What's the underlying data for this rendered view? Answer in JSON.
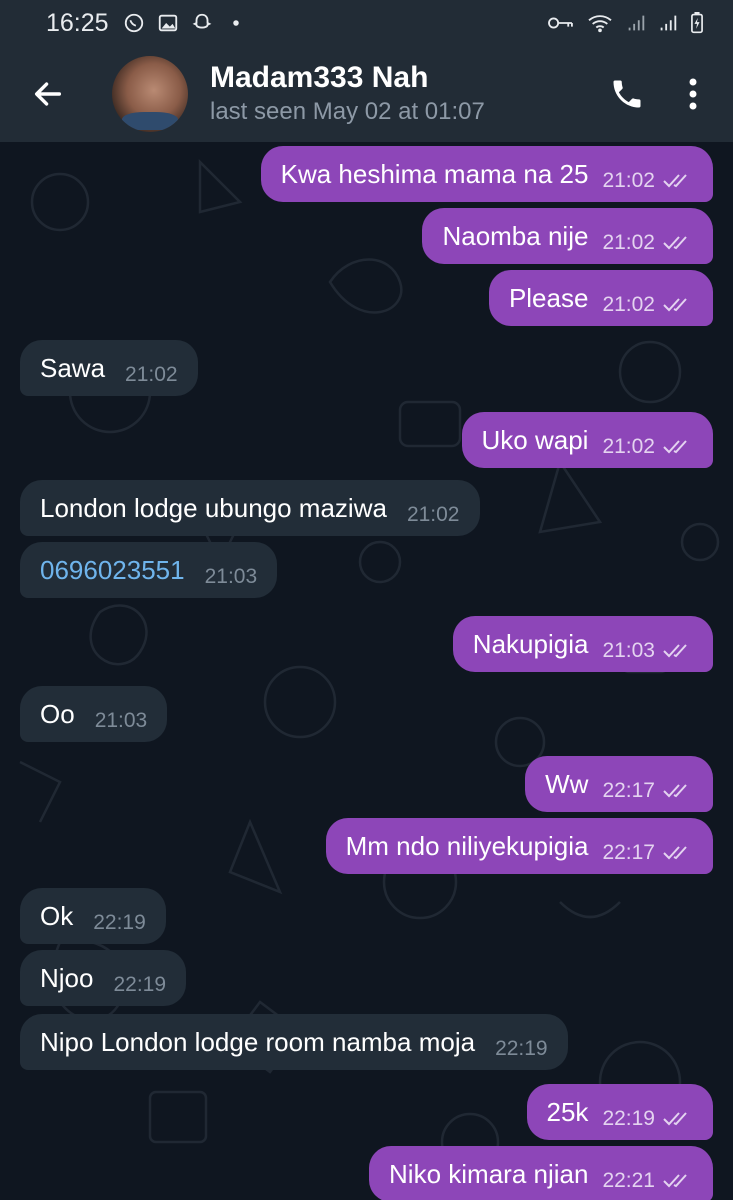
{
  "status_bar": {
    "time": "16:25",
    "notification_icons": [
      "whatsapp-icon",
      "gallery-icon",
      "snapchat-icon",
      "dot-icon"
    ],
    "system_icons": [
      "key-icon",
      "wifi-icon",
      "signal-icon",
      "signal-icon",
      "battery-charging-icon"
    ]
  },
  "header": {
    "contact_name": "Madam333 Nah",
    "last_seen": "last seen May 02 at 01:07"
  },
  "colors": {
    "header_bg": "#222c36",
    "chat_bg": "#0f1620",
    "outgoing_bubble": "#8d46b8",
    "incoming_bubble": "#222d38",
    "link": "#6fb4ec"
  },
  "messages": [
    {
      "dir": "out",
      "text": "Kwa heshima mama na 25",
      "time": "21:02"
    },
    {
      "dir": "out",
      "text": "Naomba nije",
      "time": "21:02"
    },
    {
      "dir": "out",
      "text": "Please",
      "time": "21:02"
    },
    {
      "dir": "in",
      "text": "Sawa",
      "time": "21:02"
    },
    {
      "dir": "out",
      "text": "Uko wapi",
      "time": "21:02"
    },
    {
      "dir": "in",
      "text": "London lodge ubungo maziwa",
      "time": "21:02"
    },
    {
      "dir": "in",
      "text": "0696023551",
      "time": "21:03",
      "link": true
    },
    {
      "dir": "out",
      "text": "Nakupigia",
      "time": "21:03"
    },
    {
      "dir": "in",
      "text": "Oo",
      "time": "21:03"
    },
    {
      "dir": "out",
      "text": "Ww",
      "time": "22:17"
    },
    {
      "dir": "out",
      "text": "Mm ndo niliyekupigia",
      "time": "22:17"
    },
    {
      "dir": "in",
      "text": "Ok",
      "time": "22:19"
    },
    {
      "dir": "in",
      "text": "Njoo",
      "time": "22:19"
    },
    {
      "dir": "in",
      "text": "Nipo London lodge room namba moja",
      "time": "22:19"
    },
    {
      "dir": "out",
      "text": "25k",
      "time": "22:19"
    },
    {
      "dir": "out",
      "text": "Niko kimara njian",
      "time": "22:21"
    }
  ]
}
